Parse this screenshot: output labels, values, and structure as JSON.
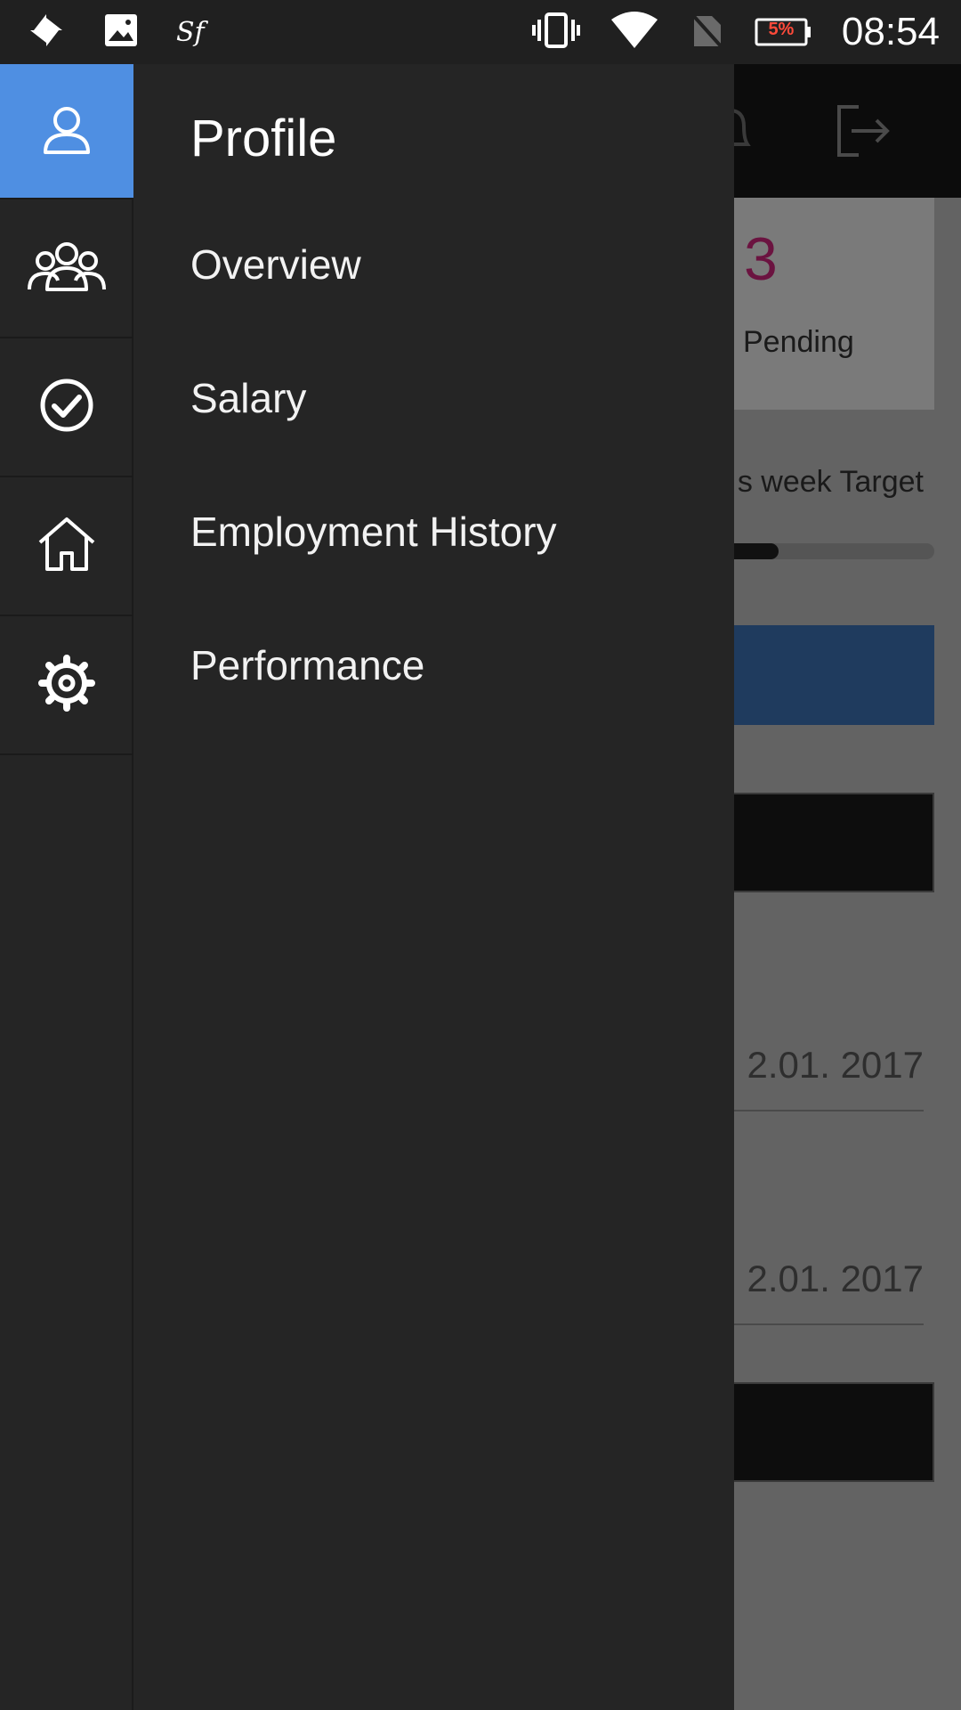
{
  "status_bar": {
    "time": "08:54",
    "battery": "5%",
    "icons": [
      "pinwheel-icon",
      "image-icon",
      "sf-logo",
      "vibrate-icon",
      "wifi-icon",
      "no-sim-icon",
      "battery-icon"
    ],
    "sf_label": "Sf"
  },
  "drawer": {
    "title": "Profile",
    "rail": [
      {
        "icon": "person-icon",
        "active": true
      },
      {
        "icon": "team-icon",
        "active": false
      },
      {
        "icon": "check-circle-icon",
        "active": false
      },
      {
        "icon": "home-icon",
        "active": false
      },
      {
        "icon": "gear-icon",
        "active": false
      }
    ],
    "menu": [
      {
        "label": "Overview"
      },
      {
        "label": "Salary"
      },
      {
        "label": "Employment History"
      },
      {
        "label": "Performance"
      }
    ]
  },
  "background": {
    "pending_count": "3",
    "pending_label": "Pending",
    "target_label": "s week Target",
    "target_progress": 0.35,
    "dates": [
      "2.01. 2017",
      "2.01. 2017"
    ]
  },
  "colors": {
    "accent": "#4f8fe2",
    "drawer_bg": "#252525",
    "pending_count": "#6b1340"
  }
}
